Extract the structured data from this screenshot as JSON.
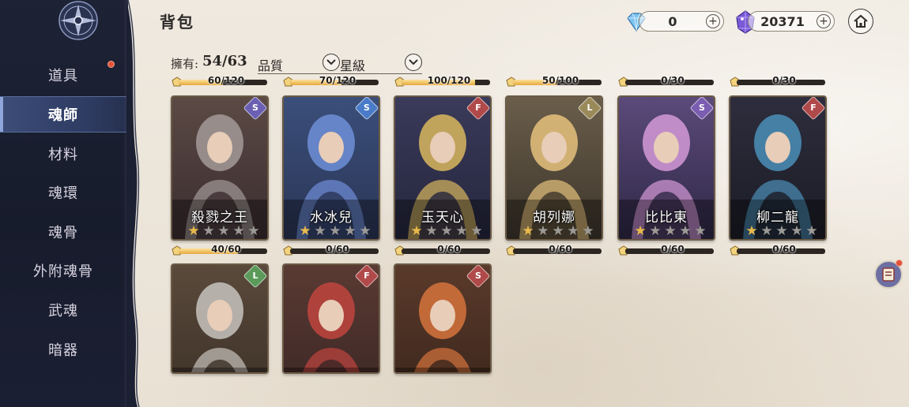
{
  "header": {
    "title": "背包",
    "currencies": [
      {
        "name": "diamond",
        "icon": "blue-diamond-icon",
        "value": "0",
        "plus": "+"
      },
      {
        "name": "soul-crystal",
        "icon": "purple-crystal-icon",
        "value": "20371",
        "plus": "+"
      }
    ]
  },
  "sidebar": {
    "items": [
      {
        "label": "道具",
        "badge": true,
        "active": false
      },
      {
        "label": "魂師",
        "badge": false,
        "active": true
      },
      {
        "label": "材料",
        "badge": false,
        "active": false
      },
      {
        "label": "魂環",
        "badge": false,
        "active": false
      },
      {
        "label": "魂骨",
        "badge": false,
        "active": false
      },
      {
        "label": "外附魂骨",
        "badge": false,
        "active": false
      },
      {
        "label": "武魂",
        "badge": false,
        "active": false
      },
      {
        "label": "暗器",
        "badge": false,
        "active": false
      }
    ]
  },
  "filters": {
    "owned_label": "擁有:",
    "owned_count": "54/63",
    "quality_label": "品質",
    "star_label": "星級"
  },
  "cards": [
    {
      "name": "殺戮之王",
      "progress_text": "60/120",
      "progress": 0.5,
      "stars": 1,
      "element_color": "#6a5fb2",
      "element_icon": "swirl-element-icon",
      "palette": [
        "#5b4a44",
        "#a39a98",
        "#3a2c30"
      ]
    },
    {
      "name": "水冰兒",
      "progress_text": "70/120",
      "progress": 0.58,
      "stars": 1,
      "element_color": "#4a7bc8",
      "element_icon": "swirl-element-icon",
      "palette": [
        "#3b4f7a",
        "#6f8fd8",
        "#2a3556"
      ]
    },
    {
      "name": "玉天心",
      "progress_text": "100/120",
      "progress": 0.83,
      "stars": 1,
      "element_color": "#b04a4a",
      "element_icon": "flame-element-icon",
      "palette": [
        "#3a3a5a",
        "#d9b75e",
        "#25263d"
      ]
    },
    {
      "name": "胡列娜",
      "progress_text": "50/100",
      "progress": 0.5,
      "stars": 1,
      "element_color": "#9a8a5a",
      "element_icon": "leaf-element-icon",
      "palette": [
        "#6a5d4a",
        "#e6c27c",
        "#3d362c"
      ]
    },
    {
      "name": "比比東",
      "progress_text": "0/30",
      "progress": 0,
      "stars": 1,
      "element_color": "#7a5cb0",
      "element_icon": "swirl-element-icon",
      "palette": [
        "#5b4a7a",
        "#d59ad8",
        "#2f2846"
      ]
    },
    {
      "name": "柳二龍",
      "progress_text": "0/30",
      "progress": 0,
      "stars": 1,
      "element_color": "#b04a4a",
      "element_icon": "flame-element-icon",
      "palette": [
        "#2d2d3d",
        "#4b8fb8",
        "#1c1c26"
      ]
    },
    {
      "name": "",
      "progress_text": "40/60",
      "progress": 0.67,
      "stars": 0,
      "element_color": "#5b9a5a",
      "element_icon": "leaf-element-icon",
      "palette": [
        "#5a4a3c",
        "#c7c3be",
        "#3b2f26"
      ]
    },
    {
      "name": "",
      "progress_text": "0/60",
      "progress": 0,
      "stars": 0,
      "element_color": "#b04a4a",
      "element_icon": "flame-element-icon",
      "palette": [
        "#5a3a33",
        "#c0453e",
        "#3a2624"
      ]
    },
    {
      "name": "",
      "progress_text": "0/60",
      "progress": 0,
      "stars": 0,
      "element_color": "#b04a4a",
      "element_icon": "swirl-element-icon",
      "palette": [
        "#5a3a2a",
        "#d6733c",
        "#3a251c"
      ]
    }
  ],
  "extra_progress": [
    {
      "progress_text": "0/60",
      "progress": 0
    },
    {
      "progress_text": "0/60",
      "progress": 0
    },
    {
      "progress_text": "0/60",
      "progress": 0
    }
  ],
  "float_button": {
    "icon": "scroll-icon",
    "badge": true
  }
}
